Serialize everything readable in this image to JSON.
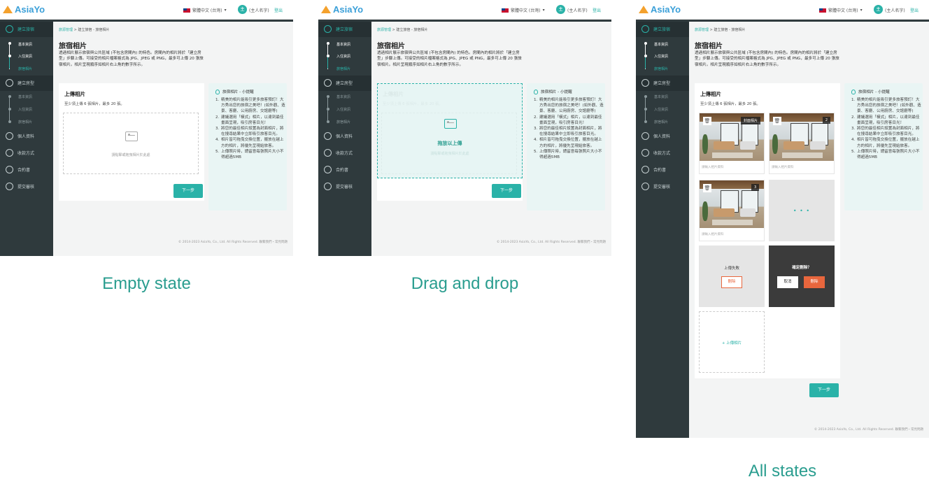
{
  "app": {
    "logo": "AsiaYo",
    "language": "繁體中文 (台灣)",
    "avatar_initial": "主",
    "user_name": "(主人名字)",
    "logout": "登出"
  },
  "colors": {
    "accent": "#2ab2a8",
    "sidebar": "#2f3a3d",
    "danger": "#e8663d",
    "logo": "#3a9fd8"
  },
  "sidebar": {
    "step1": "建立旅宿",
    "step1_subs": [
      "基本資訊",
      "入住資訊",
      "旅宿相片"
    ],
    "step2": "建立房型",
    "step2_subs": [
      "基本資訊",
      "入住資訊",
      "旅宿相片"
    ],
    "step3": "個人資料",
    "step4": "收款方式",
    "step5": "合約書",
    "step6": "提交審核"
  },
  "page": {
    "breadcrumb_link": "旅源管理",
    "breadcrumb_sep": ">",
    "breadcrumb_current": "建立旅宿 - 旅宿相片",
    "title": "旅宿相片",
    "description": "透過相片展示旅宿與公共區域 (不包含房間內) 的特色。房間內的相片將於「建立房型」步驟上傳。可接受的相片檔案格式為 JPG、JPEG 或 PNG，最多可上傳 20 張旅宿相片。相片呈現順序如相片右上角的數字所示。"
  },
  "upload": {
    "title": "上傳相片",
    "subtitle": "至少須上傳 6 張相片，最多 20 張。",
    "drop_hint": "請點擊或拖曳相片於此處",
    "drop_active": "拖放以上傳",
    "next": "下一步",
    "cover_badge": "封面相片",
    "badge_2": "2",
    "badge_3": "3",
    "caption_placeholder": "請輸入相片資料",
    "loading": "• • •",
    "fail_text": "上傳失敗",
    "delete": "刪除",
    "confirm_delete": "確定刪除？",
    "cancel": "取消",
    "add_photo": "+ 上傳相片"
  },
  "tips": {
    "title": "旅宿相片 - 小提醒",
    "items": [
      "精美的相片能吸引更多旅客預訂！大方秀出您的旅宿之美吧！(如外觀、造景、客廳、公用廚房、交誼廳等)",
      "建議選用「橫式」相片，以達到最佳畫面呈現，吸引房客目光！",
      "將您的最佳相片設置為封面相片，將在搜尋結果中立即吸引旅客目光。",
      "相片皆可拖曳交換位置，擺放在越上方的相片，將優先呈現給旅客。",
      "上傳照片時，請留意每張照片大小不得超過5MB"
    ]
  },
  "footer": "© 2014-2023 AsiaYo, Co., Ltd. All Rights Reserved.   聯繫我們・常見問題",
  "captions": {
    "empty": "Empty state",
    "drag": "Drag and drop",
    "all": "All states"
  }
}
